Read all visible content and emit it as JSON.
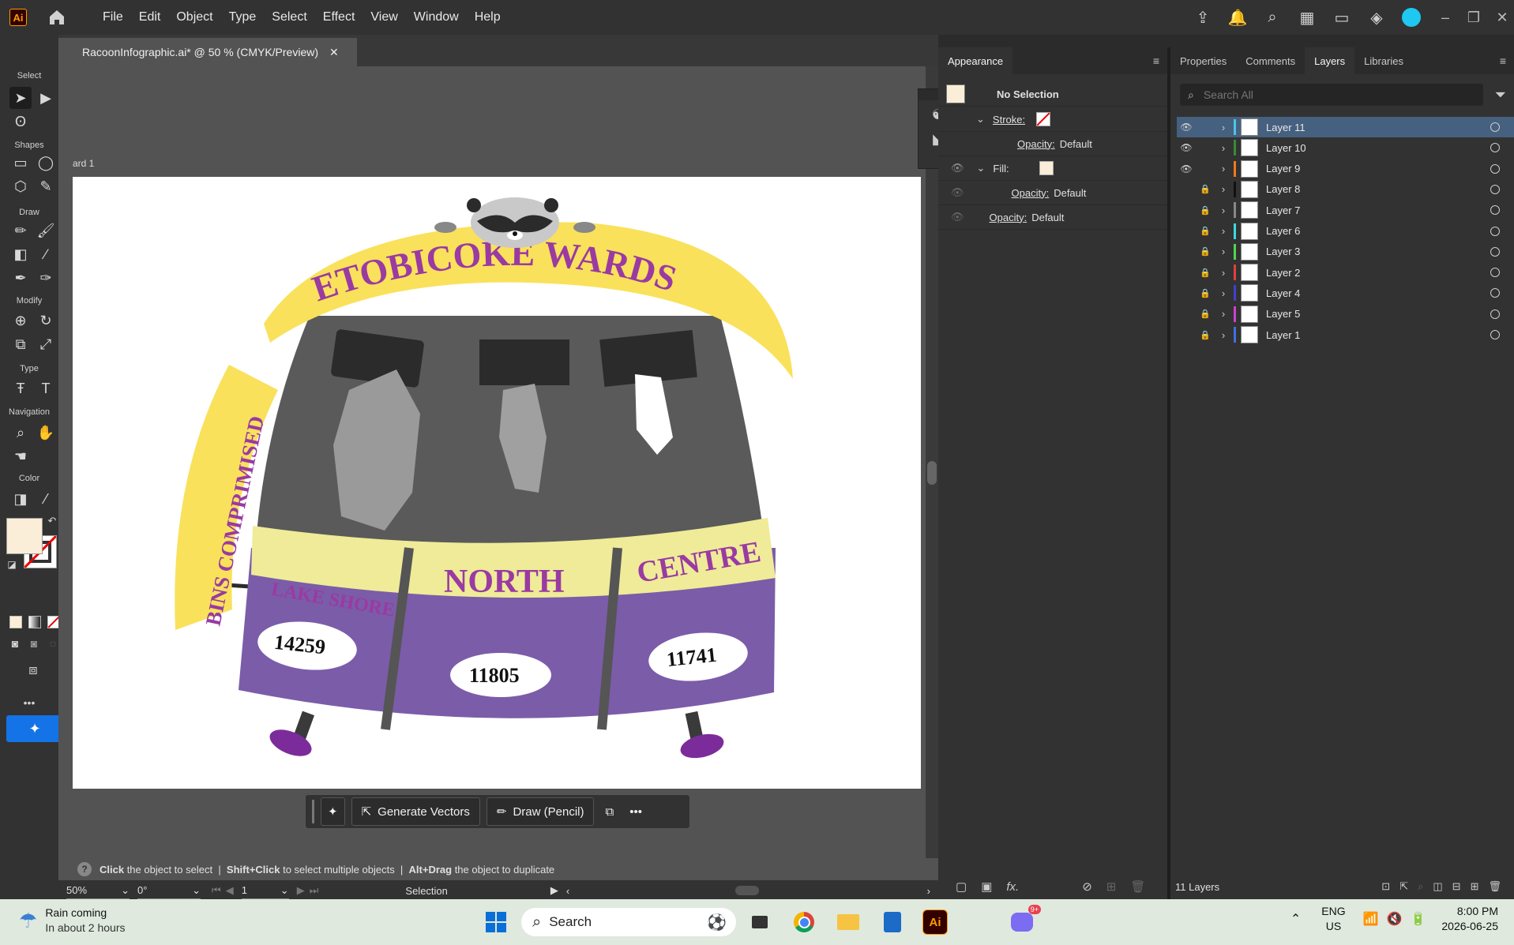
{
  "app": {
    "logo": "Ai",
    "menu": [
      "File",
      "Edit",
      "Object",
      "Type",
      "Select",
      "Effect",
      "View",
      "Window",
      "Help"
    ]
  },
  "document": {
    "tab_title": "RacoonInfographic.ai* @ 50 % (CMYK/Preview)",
    "artboard_label": "ard 1"
  },
  "toolbar": {
    "sections": {
      "select": "Select",
      "shapes": "Shapes",
      "draw": "Draw",
      "modify": "Modify",
      "type": "Type",
      "navigation": "Navigation",
      "color": "Color"
    },
    "fill_color": "#fbeed8",
    "more": "•••"
  },
  "artwork": {
    "title": "ETOBICOKE WARDS",
    "side_label": "BINS COMPRIMISED",
    "wards": [
      {
        "name": "LAKE SHORE",
        "value": "14259"
      },
      {
        "name": "NORTH",
        "value": "11805"
      },
      {
        "name": "CENTRE",
        "value": "11741"
      }
    ],
    "colors": {
      "yellow": "#f9e15b",
      "purple": "#7b5ca9",
      "label_bg": "#efeb98",
      "text_purple": "#9a3aa2",
      "body": "#5a5a5a",
      "dark": "#2b2b2b"
    }
  },
  "context_bar": {
    "generate": "Generate Vectors",
    "draw": "Draw (Pencil)",
    "more": "•••"
  },
  "hint": {
    "click": "Click",
    "click_rest": " the object to select  |  ",
    "shift": "Shift+Click",
    "shift_rest": " to select multiple objects  |  ",
    "alt": "Alt+Drag",
    "alt_rest": " the object to duplicate"
  },
  "status": {
    "zoom": "50%",
    "rotation": "0°",
    "artboard_num": "1",
    "tool": "Selection"
  },
  "appearance": {
    "tab": "Appearance",
    "no_selection": "No Selection",
    "stroke": "Stroke:",
    "fill": "Fill:",
    "opacity": "Opacity:",
    "default": "Default"
  },
  "layers_panel": {
    "tabs": [
      "Properties",
      "Comments",
      "Layers",
      "Libraries"
    ],
    "search_placeholder": "Search All",
    "count": "11 Layers",
    "layers": [
      {
        "name": "Layer 11",
        "color": "#4fc3e8",
        "visible": true,
        "locked": false
      },
      {
        "name": "Layer 10",
        "color": "#3a8a3a",
        "visible": true,
        "locked": false
      },
      {
        "name": "Layer 9",
        "color": "#f07a1a",
        "visible": true,
        "locked": false
      },
      {
        "name": "Layer 8",
        "color": "#111111",
        "visible": false,
        "locked": true
      },
      {
        "name": "Layer 7",
        "color": "#888888",
        "visible": false,
        "locked": true
      },
      {
        "name": "Layer 6",
        "color": "#3dd6e0",
        "visible": false,
        "locked": true
      },
      {
        "name": "Layer 3",
        "color": "#4fd64f",
        "visible": false,
        "locked": true
      },
      {
        "name": "Layer 2",
        "color": "#e04040",
        "visible": false,
        "locked": true
      },
      {
        "name": "Layer 4",
        "color": "#4040d0",
        "visible": false,
        "locked": true
      },
      {
        "name": "Layer 5",
        "color": "#d040d0",
        "visible": false,
        "locked": true
      },
      {
        "name": "Layer 1",
        "color": "#4070e0",
        "visible": false,
        "locked": true
      }
    ]
  },
  "taskbar": {
    "weather_title": "Rain coming",
    "weather_sub": "In about 2 hours",
    "search": "Search",
    "lang": "ENG",
    "region": "US",
    "time": "8:00 PM",
    "date": "2026-06-25",
    "badge": "9+"
  }
}
